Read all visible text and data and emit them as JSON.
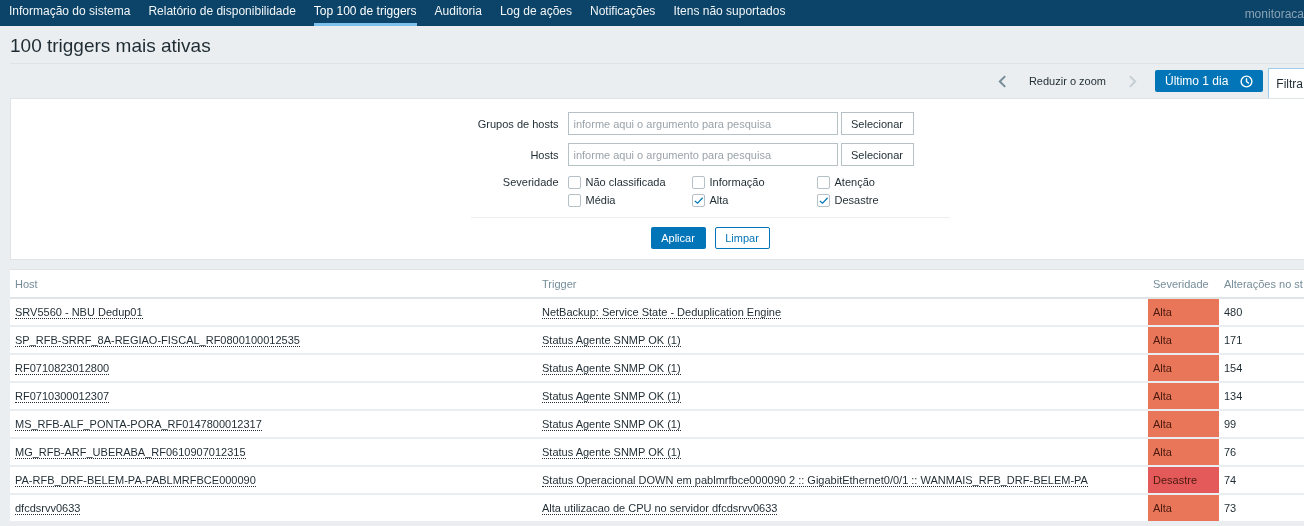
{
  "nav": {
    "items": [
      {
        "label": "Informação do sistema",
        "selected": false
      },
      {
        "label": "Relatório de disponibilidade",
        "selected": false
      },
      {
        "label": "Top 100 de triggers",
        "selected": true
      },
      {
        "label": "Auditoria",
        "selected": false
      },
      {
        "label": "Log de ações",
        "selected": false
      },
      {
        "label": "Notificações",
        "selected": false
      },
      {
        "label": "Itens não suportados",
        "selected": false
      }
    ],
    "user": "monitoraca"
  },
  "title": "100 triggers mais ativas",
  "toolbar": {
    "prev_disabled": false,
    "zoom_out": "Reduzir o zoom",
    "next_disabled": true,
    "time_range": "Último 1 dia",
    "filter_tab": "Filtra"
  },
  "filter": {
    "fields": [
      {
        "label": "Grupos de hosts",
        "placeholder": "informe aqui o argumento para pesquisa",
        "button": "Selecionar"
      },
      {
        "label": "Hosts",
        "placeholder": "informe aqui o argumento para pesquisa",
        "button": "Selecionar"
      }
    ],
    "severity_label": "Severidade",
    "severities": [
      {
        "label": "Não classificada",
        "checked": false
      },
      {
        "label": "Informação",
        "checked": false
      },
      {
        "label": "Atenção",
        "checked": false
      },
      {
        "label": "Média",
        "checked": false
      },
      {
        "label": "Alta",
        "checked": true
      },
      {
        "label": "Desastre",
        "checked": true
      }
    ],
    "apply": "Aplicar",
    "reset": "Limpar"
  },
  "table": {
    "columns": [
      "Host",
      "Trigger",
      "Severidade",
      "Alterações no st"
    ],
    "rows": [
      {
        "host": "SRV5560 - NBU Dedup01",
        "trigger": "NetBackup: Service State - Deduplication Engine",
        "severity": "Alta",
        "color": "#e97659",
        "changes": "480"
      },
      {
        "host": "SP_RFB-SRRF_8A-REGIAO-FISCAL_RF0800100012535",
        "trigger": "Status Agente SNMP OK (1)",
        "severity": "Alta",
        "color": "#e97659",
        "changes": "171"
      },
      {
        "host": "RF0710823012800",
        "trigger": "Status Agente SNMP OK (1)",
        "severity": "Alta",
        "color": "#e97659",
        "changes": "154"
      },
      {
        "host": "RF0710300012307",
        "trigger": "Status Agente SNMP OK (1)",
        "severity": "Alta",
        "color": "#e97659",
        "changes": "134"
      },
      {
        "host": "MS_RFB-ALF_PONTA-PORA_RF0147800012317",
        "trigger": "Status Agente SNMP OK (1)",
        "severity": "Alta",
        "color": "#e97659",
        "changes": "99"
      },
      {
        "host": "MG_RFB-ARF_UBERABA_RF0610907012315",
        "trigger": "Status Agente SNMP OK (1)",
        "severity": "Alta",
        "color": "#e97659",
        "changes": "76"
      },
      {
        "host": "PA-RFB_DRF-BELEM-PA-PABLMRFBCE000090",
        "trigger": "Status Operacional DOWN em pablmrfbce000090 2 :: GigabitEthernet0/0/1 :: WANMAIS_RFB_DRF-BELEM-PA",
        "severity": "Desastre",
        "color": "#e45959",
        "changes": "74"
      },
      {
        "host": "dfcdsrvv0633",
        "trigger": "Alta utilizacao de CPU no servidor dfcdsrvv0633",
        "severity": "Alta",
        "color": "#e97659",
        "changes": "73"
      }
    ]
  }
}
